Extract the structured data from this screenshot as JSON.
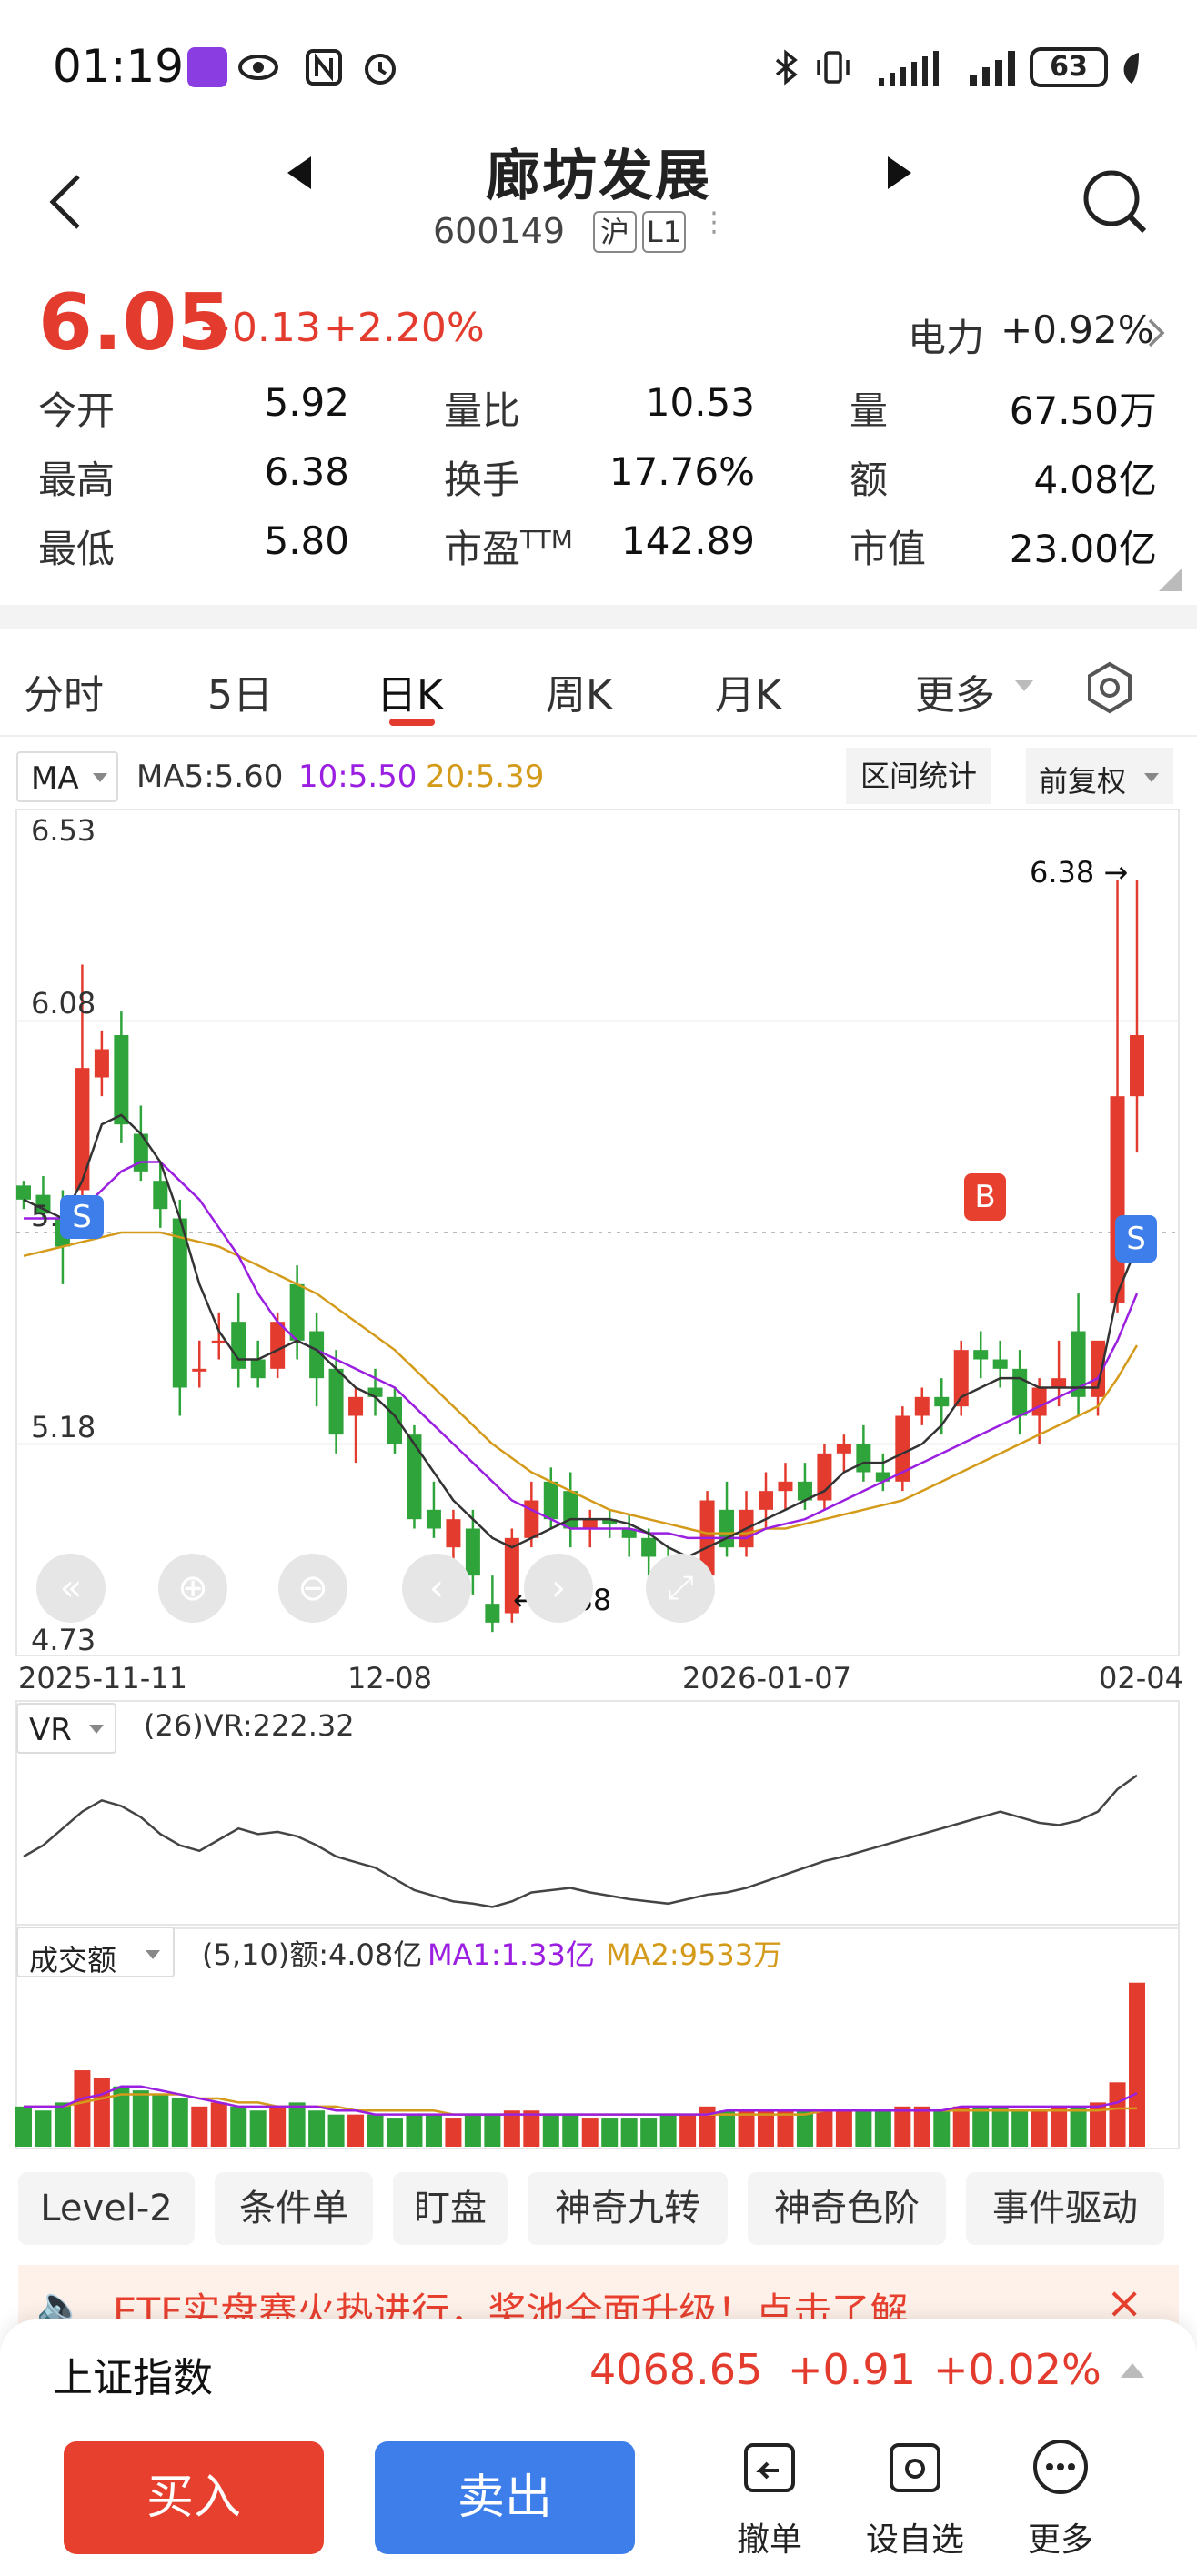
{
  "status_bar": {
    "time": "01:19",
    "battery": "63"
  },
  "header": {
    "title": "廊坊发展",
    "code": "600149",
    "exchange_tag": "沪",
    "level_tag": "L1"
  },
  "quote": {
    "price": "6.05",
    "change": "+0.13",
    "change_pct": "+2.20%",
    "sector_label": "电力",
    "sector_change": "+0.92%",
    "rows": [
      {
        "l1": "今开",
        "v1": "5.92",
        "l2": "量比",
        "v2": "10.53",
        "l3": "量",
        "v3": "67.50万"
      },
      {
        "l1": "最高",
        "v1": "6.38",
        "l2": "换手",
        "v2": "17.76%",
        "l3": "额",
        "v3": "4.08亿"
      },
      {
        "l1": "最低",
        "v1": "5.80",
        "l2": "市盈",
        "l2sup": "TTM",
        "v2": "142.89",
        "l3": "市值",
        "v3": "23.00亿"
      }
    ]
  },
  "tabs": [
    "分时",
    "5日",
    "日K",
    "周K",
    "月K",
    "更多"
  ],
  "active_tab": "日K",
  "kline": {
    "indicator": "MA",
    "ma5": "MA5:5.60",
    "ma10": "10:5.50",
    "ma20": "20:5.39",
    "range_btn": "区间统计",
    "adjust": "前复权",
    "y_labels": [
      "6.53",
      "6.08",
      "5.63",
      "5.18",
      "4.73"
    ],
    "x_labels": [
      "2025-11-11",
      "12-08",
      "2026-01-07",
      "02-04"
    ],
    "max_label": "6.38",
    "min_label": "4.88",
    "marker_b": "B",
    "marker_s": "S"
  },
  "vr": {
    "indicator": "VR",
    "text": "(26)VR:222.32"
  },
  "volume": {
    "indicator": "成交额",
    "text": "(5,10)额:4.08亿",
    "ma1": "MA1:1.33亿",
    "ma2": "MA2:9533万"
  },
  "tools": [
    "Level-2",
    "条件单",
    "盯盘",
    "神奇九转",
    "神奇色阶",
    "事件驱动"
  ],
  "banner": "ETF实盘赛火热进行，奖池全面升级！点击了解",
  "index": {
    "name": "上证指数",
    "value": "4068.65",
    "change": "+0.91",
    "pct": "+0.02%"
  },
  "actions": {
    "buy": "买入",
    "sell": "卖出",
    "cancel": "撤单",
    "watch": "设自选",
    "more": "更多"
  },
  "colors": {
    "up": "#e33b2e",
    "down": "#2ea43a",
    "ma5": "#333333",
    "ma10": "#9b1fe0",
    "ma20": "#d49a1a"
  },
  "chart_data": {
    "type": "candlestick",
    "title": "",
    "ylim": [
      4.73,
      6.53
    ],
    "y_ticks": [
      6.53,
      6.08,
      5.63,
      5.18,
      4.73
    ],
    "x_ticks": [
      "2025-11-11",
      "12-08",
      "2026-01-07",
      "02-04"
    ],
    "series": [
      {
        "name": "",
        "ohlc": [
          [
            5.73,
            5.74,
            5.68,
            5.7
          ],
          [
            5.71,
            5.75,
            5.66,
            5.67
          ],
          [
            5.66,
            5.72,
            5.52,
            5.6
          ],
          [
            5.72,
            6.2,
            5.7,
            5.98
          ],
          [
            5.96,
            6.06,
            5.92,
            6.02
          ],
          [
            6.05,
            6.1,
            5.82,
            5.86
          ],
          [
            5.84,
            5.9,
            5.74,
            5.76
          ],
          [
            5.74,
            5.78,
            5.64,
            5.68
          ],
          [
            5.66,
            5.7,
            5.24,
            5.3
          ],
          [
            5.34,
            5.4,
            5.3,
            5.34
          ],
          [
            5.4,
            5.46,
            5.36,
            5.4
          ],
          [
            5.44,
            5.5,
            5.3,
            5.34
          ],
          [
            5.36,
            5.4,
            5.3,
            5.32
          ],
          [
            5.34,
            5.46,
            5.32,
            5.44
          ],
          [
            5.52,
            5.56,
            5.36,
            5.4
          ],
          [
            5.42,
            5.46,
            5.26,
            5.32
          ],
          [
            5.34,
            5.38,
            5.16,
            5.2
          ],
          [
            5.24,
            5.3,
            5.14,
            5.28
          ],
          [
            5.3,
            5.34,
            5.24,
            5.28
          ],
          [
            5.28,
            5.3,
            5.16,
            5.18
          ],
          [
            5.2,
            5.22,
            5.0,
            5.02
          ],
          [
            5.04,
            5.1,
            4.98,
            5.0
          ],
          [
            4.96,
            5.04,
            4.92,
            5.02
          ],
          [
            5.0,
            5.04,
            4.86,
            4.9
          ],
          [
            4.84,
            4.9,
            4.78,
            4.8
          ],
          [
            4.82,
            5.0,
            4.8,
            4.98
          ],
          [
            4.98,
            5.1,
            4.96,
            5.06
          ],
          [
            5.1,
            5.13,
            5.0,
            5.02
          ],
          [
            5.08,
            5.12,
            4.96,
            5.0
          ],
          [
            5.0,
            5.04,
            4.96,
            5.02
          ],
          [
            5.02,
            5.04,
            4.98,
            5.01
          ],
          [
            5.0,
            5.03,
            4.94,
            4.98
          ],
          [
            4.98,
            5.0,
            4.9,
            4.94
          ],
          [
            4.92,
            4.96,
            4.84,
            4.88
          ],
          [
            4.9,
            4.94,
            4.86,
            4.92
          ],
          [
            4.9,
            5.08,
            4.88,
            5.06
          ],
          [
            5.04,
            5.1,
            4.94,
            4.96
          ],
          [
            4.96,
            5.08,
            4.94,
            5.04
          ],
          [
            5.04,
            5.12,
            5.0,
            5.08
          ],
          [
            5.08,
            5.14,
            5.04,
            5.1
          ],
          [
            5.1,
            5.14,
            5.04,
            5.06
          ],
          [
            5.06,
            5.18,
            5.04,
            5.16
          ],
          [
            5.16,
            5.2,
            5.12,
            5.18
          ],
          [
            5.18,
            5.22,
            5.1,
            5.12
          ],
          [
            5.12,
            5.16,
            5.08,
            5.1
          ],
          [
            5.1,
            5.26,
            5.08,
            5.24
          ],
          [
            5.24,
            5.3,
            5.22,
            5.28
          ],
          [
            5.28,
            5.32,
            5.2,
            5.26
          ],
          [
            5.26,
            5.4,
            5.24,
            5.38
          ],
          [
            5.38,
            5.42,
            5.32,
            5.36
          ],
          [
            5.36,
            5.4,
            5.3,
            5.34
          ],
          [
            5.34,
            5.38,
            5.2,
            5.24
          ],
          [
            5.24,
            5.32,
            5.18,
            5.3
          ],
          [
            5.3,
            5.4,
            5.26,
            5.32
          ],
          [
            5.42,
            5.5,
            5.24,
            5.28
          ],
          [
            5.28,
            5.34,
            5.24,
            5.4
          ],
          [
            5.48,
            6.38,
            5.46,
            5.92
          ],
          [
            5.92,
            6.38,
            5.8,
            6.05
          ]
        ]
      }
    ],
    "ma5": [
      5.7,
      5.68,
      5.66,
      5.74,
      5.86,
      5.88,
      5.84,
      5.78,
      5.66,
      5.52,
      5.42,
      5.36,
      5.36,
      5.38,
      5.4,
      5.38,
      5.34,
      5.3,
      5.28,
      5.24,
      5.18,
      5.12,
      5.06,
      5.02,
      4.98,
      4.96,
      4.98,
      5.0,
      5.02,
      5.02,
      5.02,
      5.01,
      4.99,
      4.96,
      4.94,
      4.96,
      4.98,
      5.0,
      5.02,
      5.04,
      5.06,
      5.08,
      5.12,
      5.14,
      5.14,
      5.16,
      5.18,
      5.22,
      5.28,
      5.3,
      5.32,
      5.32,
      5.3,
      5.3,
      5.3,
      5.3,
      5.5,
      5.6
    ],
    "ma10": [
      5.66,
      5.66,
      5.66,
      5.68,
      5.72,
      5.76,
      5.78,
      5.78,
      5.74,
      5.7,
      5.64,
      5.58,
      5.5,
      5.44,
      5.4,
      5.38,
      5.36,
      5.34,
      5.32,
      5.3,
      5.26,
      5.22,
      5.18,
      5.14,
      5.1,
      5.06,
      5.04,
      5.02,
      5.0,
      5.0,
      5.0,
      5.0,
      4.99,
      4.99,
      4.98,
      4.98,
      4.98,
      4.98,
      5.0,
      5.01,
      5.02,
      5.04,
      5.06,
      5.08,
      5.1,
      5.12,
      5.14,
      5.16,
      5.18,
      5.2,
      5.22,
      5.24,
      5.26,
      5.28,
      5.3,
      5.32,
      5.4,
      5.5
    ],
    "ma20": [
      5.58,
      5.59,
      5.6,
      5.61,
      5.62,
      5.63,
      5.63,
      5.63,
      5.62,
      5.61,
      5.6,
      5.58,
      5.56,
      5.54,
      5.52,
      5.5,
      5.47,
      5.44,
      5.41,
      5.38,
      5.34,
      5.3,
      5.26,
      5.22,
      5.18,
      5.15,
      5.12,
      5.1,
      5.08,
      5.06,
      5.04,
      5.03,
      5.02,
      5.01,
      5.0,
      4.99,
      4.99,
      4.99,
      5.0,
      5.0,
      5.01,
      5.02,
      5.03,
      5.04,
      5.05,
      5.06,
      5.08,
      5.1,
      5.12,
      5.14,
      5.16,
      5.18,
      5.2,
      5.22,
      5.24,
      5.26,
      5.32,
      5.39
    ],
    "vr": [
      150,
      160,
      175,
      190,
      200,
      195,
      185,
      170,
      160,
      155,
      165,
      175,
      170,
      172,
      168,
      160,
      150,
      145,
      140,
      130,
      120,
      115,
      110,
      108,
      105,
      110,
      118,
      120,
      122,
      118,
      115,
      112,
      110,
      108,
      112,
      116,
      118,
      122,
      128,
      134,
      140,
      146,
      150,
      155,
      160,
      165,
      170,
      175,
      180,
      185,
      190,
      185,
      180,
      178,
      182,
      190,
      210,
      222.32
    ],
    "amount": [
      1.0,
      0.9,
      1.1,
      1.9,
      1.7,
      1.5,
      1.4,
      1.3,
      1.2,
      1.0,
      1.1,
      1.0,
      0.9,
      1.0,
      1.1,
      0.9,
      0.8,
      0.8,
      0.8,
      0.7,
      0.8,
      0.8,
      0.7,
      0.8,
      0.8,
      0.9,
      0.9,
      0.8,
      0.8,
      0.7,
      0.7,
      0.7,
      0.7,
      0.8,
      0.8,
      1.0,
      0.9,
      0.9,
      0.9,
      0.9,
      0.9,
      0.9,
      0.9,
      0.9,
      0.9,
      1.0,
      1.0,
      0.9,
      1.0,
      1.0,
      1.0,
      0.9,
      0.9,
      1.0,
      1.0,
      1.1,
      1.6,
      4.08
    ],
    "amount_ma1": [
      1.0,
      1.0,
      1.0,
      1.2,
      1.3,
      1.5,
      1.5,
      1.4,
      1.3,
      1.2,
      1.1,
      1.0,
      1.0,
      1.0,
      1.0,
      1.0,
      0.9,
      0.9,
      0.8,
      0.8,
      0.8,
      0.8,
      0.8,
      0.8,
      0.8,
      0.8,
      0.8,
      0.8,
      0.8,
      0.8,
      0.8,
      0.8,
      0.8,
      0.8,
      0.8,
      0.8,
      0.9,
      0.9,
      0.9,
      0.9,
      0.9,
      0.9,
      0.9,
      0.9,
      0.9,
      0.9,
      0.9,
      0.9,
      1.0,
      1.0,
      1.0,
      1.0,
      1.0,
      1.0,
      1.0,
      1.0,
      1.1,
      1.33
    ],
    "amount_ma2": [
      1.0,
      1.0,
      1.0,
      1.1,
      1.2,
      1.3,
      1.3,
      1.3,
      1.3,
      1.2,
      1.2,
      1.1,
      1.1,
      1.0,
      1.0,
      1.0,
      1.0,
      0.9,
      0.9,
      0.9,
      0.9,
      0.9,
      0.8,
      0.8,
      0.8,
      0.8,
      0.8,
      0.8,
      0.8,
      0.8,
      0.8,
      0.8,
      0.8,
      0.8,
      0.8,
      0.8,
      0.8,
      0.8,
      0.8,
      0.8,
      0.8,
      0.9,
      0.9,
      0.9,
      0.9,
      0.9,
      0.9,
      0.9,
      0.9,
      0.9,
      0.9,
      0.9,
      0.9,
      0.9,
      0.9,
      0.9,
      0.95,
      0.9533
    ]
  }
}
